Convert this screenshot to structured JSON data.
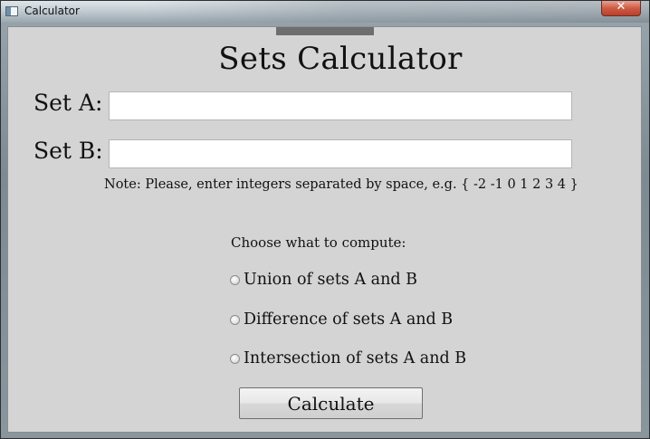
{
  "window": {
    "title": "Calculator",
    "close_glyph": "✕"
  },
  "heading": "Sets Calculator",
  "set_a": {
    "label": "Set A:",
    "value": ""
  },
  "set_b": {
    "label": "Set B:",
    "value": ""
  },
  "note": "Note: Please, enter integers separated by space, e.g. { -2 -1 0 1 2 3 4 }",
  "choose_label": "Choose what to compute:",
  "options": [
    {
      "label": "Union of sets A and B",
      "checked": false
    },
    {
      "label": "Difference of sets A and B",
      "checked": false
    },
    {
      "label": "Intersection of sets A and B",
      "checked": false
    }
  ],
  "calculate_button": "Calculate"
}
